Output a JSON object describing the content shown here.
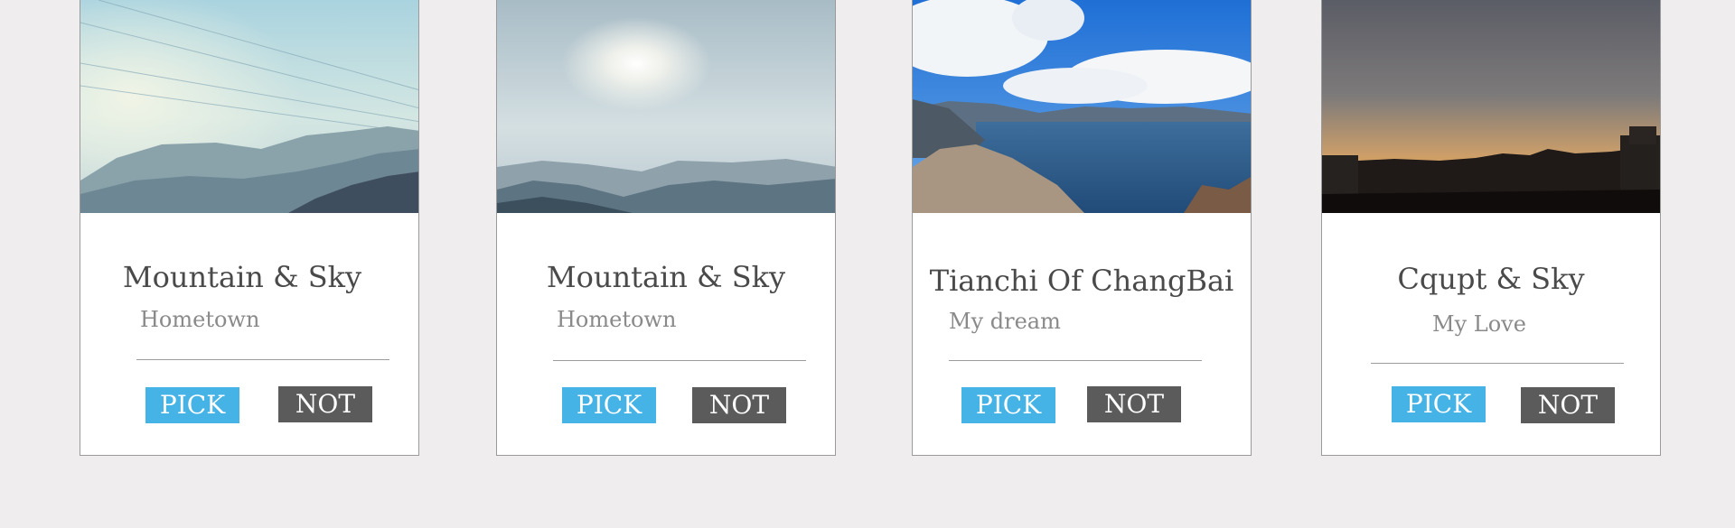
{
  "cards": [
    {
      "title": "Mountain & Sky",
      "subtitle": "Hometown",
      "pick_label": "PICK",
      "not_label": "NOT",
      "photo": "misty-mountains-with-power-lines"
    },
    {
      "title": "Mountain & Sky",
      "subtitle": "Hometown",
      "pick_label": "PICK",
      "not_label": "NOT",
      "photo": "hazy-sun-over-mountains"
    },
    {
      "title": "Tianchi Of ChangBai",
      "subtitle": "My dream",
      "pick_label": "PICK",
      "not_label": "NOT",
      "photo": "crater-lake-blue-sky"
    },
    {
      "title": "Cqupt & Sky",
      "subtitle": "My Love",
      "pick_label": "PICK",
      "not_label": "NOT",
      "photo": "sunset-skyline"
    }
  ],
  "colors": {
    "pick": "#45b3e6",
    "not": "#5b5b5b",
    "background": "#efeded"
  }
}
